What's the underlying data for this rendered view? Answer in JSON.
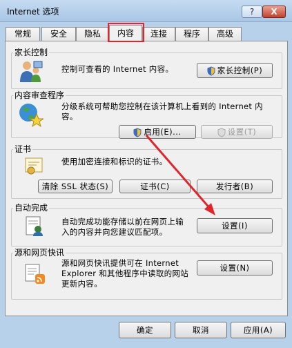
{
  "window": {
    "title": "Internet 选项",
    "help_label": "?",
    "close_label": "X"
  },
  "tabs": [
    {
      "label": "常规"
    },
    {
      "label": "安全"
    },
    {
      "label": "隐私"
    },
    {
      "label": "内容"
    },
    {
      "label": "连接"
    },
    {
      "label": "程序"
    },
    {
      "label": "高级"
    }
  ],
  "active_tab": "内容",
  "colors": {
    "highlight": "#e0262c",
    "arrow": "#e0262c"
  },
  "groups": {
    "parental": {
      "title": "家长控制",
      "description": "控制可查看的 Internet 内容。",
      "button": "家长控制(P)"
    },
    "advisor": {
      "title": "内容审查程序",
      "description_line1": "分级系统可帮助您控制在该计算机上看到的 Internet 内",
      "description_line2": "容。",
      "enable_button": "启用(E)...",
      "settings_button": "设置(T)"
    },
    "certificates": {
      "title": "证书",
      "description": "使用加密连接和标识的证书。",
      "clear_ssl_button": "清除 SSL 状态(S)",
      "certificates_button": "证书(C)",
      "publishers_button": "发行者(B)"
    },
    "autocomplete": {
      "title": "自动完成",
      "description_line1": "自动完成功能存储以前在网页上输",
      "description_line2": "入的内容并向您建议匹配项。",
      "settings_button": "设置(I)"
    },
    "feeds": {
      "title": "源和网页快讯",
      "description_line1": "源和网页快讯提供可在 Internet",
      "description_line2": "Explorer 和其他程序中读取的网站",
      "description_line3": "更新内容。",
      "settings_button": "设置(N)"
    }
  },
  "footer": {
    "ok_button": "确定",
    "cancel_button": "取消",
    "apply_button": "应用(A)"
  },
  "icons": {
    "parental": "parental-control-icon",
    "advisor": "content-advisor-icon",
    "certificates": "certificate-icon",
    "autocomplete": "autocomplete-icon",
    "feeds": "feeds-icon",
    "shield": "uac-shield-icon"
  }
}
